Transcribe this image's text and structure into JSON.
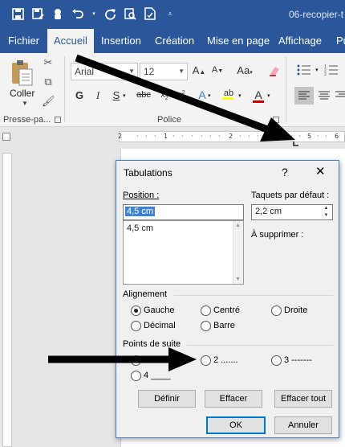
{
  "window": {
    "doc_title": "06-recopier-t"
  },
  "ribbon_tabs": [
    {
      "label": "Fichier"
    },
    {
      "label": "Accueil"
    },
    {
      "label": "Insertion"
    },
    {
      "label": "Création"
    },
    {
      "label": "Mise en page"
    },
    {
      "label": "Affichage"
    },
    {
      "label": "Pu"
    }
  ],
  "clipboard": {
    "paste_label": "Coller",
    "group_label": "Presse-pa..."
  },
  "font_group": {
    "font_name": "Arial",
    "font_size": "12",
    "group_label": "Police"
  },
  "dialog": {
    "title": "Tabulations",
    "help": "?",
    "close": "✕",
    "position_label": "Position :",
    "position_value": "4,5 cm",
    "position_list": [
      "4,5 cm"
    ],
    "default_tabs_label": "Taquets par défaut :",
    "default_tabs_value": "2,2 cm",
    "to_remove_label": "À supprimer :",
    "alignment_label": "Alignement",
    "alignment": {
      "left": "Gauche",
      "center": "Centré",
      "right": "Droite",
      "decimal": "Décimal",
      "bar": "Barre",
      "selected": "Gauche"
    },
    "leader_label": "Points de suite",
    "leaders": {
      "l1": "1 Aucun",
      "l2": "2 .......",
      "l3": "3 -------",
      "l4": "4 ____",
      "selected": "1 Aucun"
    },
    "buttons": {
      "set": "Définir",
      "clear": "Effacer",
      "clear_all": "Effacer tout",
      "ok": "OK",
      "cancel": "Annuler"
    }
  },
  "colors": {
    "word_blue": "#2b579a",
    "highlight": "#ffff00",
    "font_red": "#d00000",
    "selection": "#3e84d6"
  }
}
